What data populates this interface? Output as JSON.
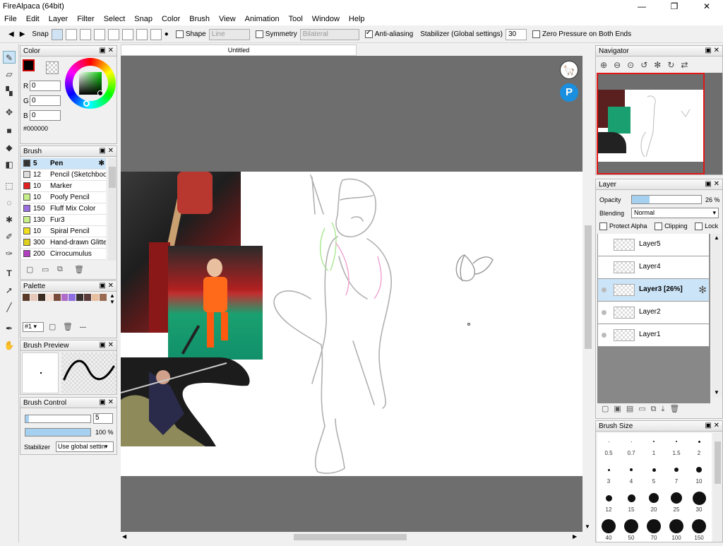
{
  "window": {
    "title": "FireAlpaca (64bit)",
    "minimize": "—",
    "maximize": "❐",
    "close": "✕"
  },
  "menu": [
    "File",
    "Edit",
    "Layer",
    "Filter",
    "Select",
    "Snap",
    "Color",
    "Brush",
    "View",
    "Animation",
    "Tool",
    "Window",
    "Help"
  ],
  "toolbar": {
    "prev": "◀",
    "next": "▶",
    "snap": "Snap",
    "shape": "Shape",
    "shape_value": "Line",
    "symmetry": "Symmetry",
    "symmetry_value": "Bilateral",
    "antialias": "Anti-aliasing",
    "stabilizer": "Stabilizer (Global settings)",
    "stabilizer_value": "30",
    "zero_pressure": "Zero Pressure on Both Ends"
  },
  "tabs": {
    "canvas": "Untitled"
  },
  "color_panel": {
    "title": "Color",
    "r": "0",
    "g": "0",
    "b": "0",
    "hex": "#000000",
    "labels": [
      "R",
      "G",
      "B"
    ],
    "fg": "#000000",
    "ring_red": "#cc0000"
  },
  "brush_panel": {
    "title": "Brush",
    "items": [
      {
        "size": "5",
        "name": "Pen",
        "color": "#333333",
        "selected": true
      },
      {
        "size": "12",
        "name": "Pencil (Sketchbook)",
        "color": "#dddddd"
      },
      {
        "size": "10",
        "name": "Marker",
        "color": "#e02020"
      },
      {
        "size": "10",
        "name": "Poofy Pencil",
        "color": "#c8f08a"
      },
      {
        "size": "150",
        "name": "Fluff Mix Color",
        "color": "#9a6de0"
      },
      {
        "size": "130",
        "name": "Fur3",
        "color": "#c8f08a"
      },
      {
        "size": "10",
        "name": "Spiral Pencil",
        "color": "#f0e020"
      },
      {
        "size": "300",
        "name": "Hand-drawn Glitter",
        "color": "#e0d020"
      },
      {
        "size": "200",
        "name": "Cirrocumulus",
        "color": "#b040c0"
      }
    ]
  },
  "palette_panel": {
    "title": "Palette",
    "swatches": [
      "#5b3a29",
      "#e8c8b8",
      "#3a2a22",
      "#f5dcd0",
      "#7a4a3a",
      "#b06ac8",
      "#8e6ee0",
      "#3a3030",
      "#5a3a3a",
      "#e8c0a0",
      "#9a6a50"
    ],
    "selector": "#1",
    "more": "---"
  },
  "brush_preview": {
    "title": "Brush Preview"
  },
  "brush_control": {
    "title": "Brush Control",
    "size": "5",
    "opacity_label": "100 %",
    "opacity": 1.0,
    "size_fraction": 0.05,
    "stabilizer_label": "Stabilizer",
    "stabilizer_value": "Use global setting"
  },
  "navigator": {
    "title": "Navigator"
  },
  "layer_panel": {
    "title": "Layer",
    "opacity_label": "Opacity",
    "opacity_value": "26 %",
    "opacity": 0.26,
    "blending_label": "Blending",
    "blending_value": "Normal",
    "protect_alpha": "Protect Alpha",
    "clipping": "Clipping",
    "lock": "Lock",
    "layers": [
      {
        "name": "Layer5"
      },
      {
        "name": "Layer4"
      },
      {
        "name": "Layer3 [26%]",
        "selected": true
      },
      {
        "name": "Layer2"
      },
      {
        "name": "Layer1"
      }
    ]
  },
  "brush_size": {
    "title": "Brush Size",
    "sizes": [
      "0.5",
      "0.7",
      "1",
      "1.5",
      "2",
      "3",
      "4",
      "5",
      "7",
      "10",
      "12",
      "15",
      "20",
      "25",
      "30",
      "40",
      "50",
      "70",
      "100",
      "150"
    ]
  }
}
